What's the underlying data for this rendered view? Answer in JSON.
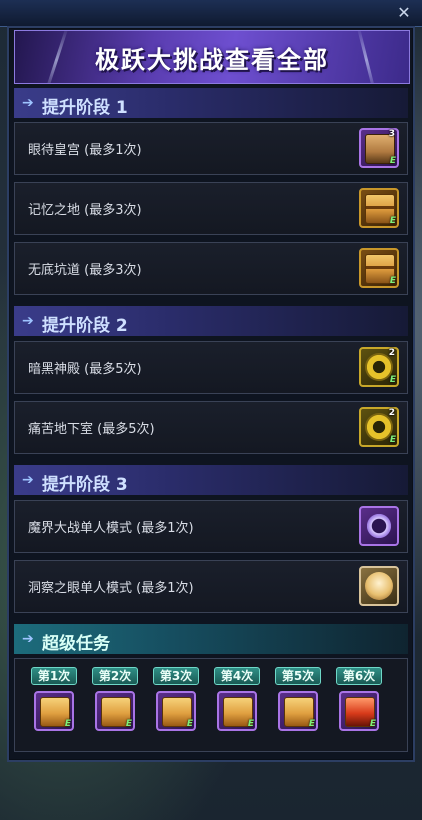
{
  "window": {
    "close_label": "✕"
  },
  "title": "极跃大挑战查看全部",
  "sections": [
    {
      "label": "提升阶段 1",
      "rows": [
        {
          "name": "眼待皇宫 (最多1次)",
          "icon": "purple-treasure-chest-icon",
          "count": "3"
        },
        {
          "name": "记忆之地 (最多3次)",
          "icon": "gold-treasure-chest-icon",
          "count": ""
        },
        {
          "name": "无底坑道 (最多3次)",
          "icon": "gold-treasure-chest-icon",
          "count": ""
        }
      ]
    },
    {
      "label": "提升阶段 2",
      "rows": [
        {
          "name": "暗黑神殿 (最多5次)",
          "icon": "golden-gear-icon",
          "count": "2"
        },
        {
          "name": "痛苦地下室 (最多5次)",
          "icon": "golden-gear-icon",
          "count": "2"
        }
      ]
    },
    {
      "label": "提升阶段 3",
      "rows": [
        {
          "name": "魔界大战单人模式 (最多1次)",
          "icon": "purple-ring-icon",
          "count": ""
        },
        {
          "name": "洞察之眼单人模式 (最多1次)",
          "icon": "white-mask-icon",
          "count": ""
        }
      ]
    }
  ],
  "super_task": {
    "label": "超级任务",
    "slots": [
      {
        "tag": "第1次",
        "icon": "gold-box-icon"
      },
      {
        "tag": "第2次",
        "icon": "gold-box-icon"
      },
      {
        "tag": "第3次",
        "icon": "gold-box-icon"
      },
      {
        "tag": "第4次",
        "icon": "gold-box-icon"
      },
      {
        "tag": "第5次",
        "icon": "gold-box-icon"
      },
      {
        "tag": "第6次",
        "icon": "red-box-icon"
      }
    ]
  },
  "badge_text": "E",
  "colors": {
    "panel_bg": "#0e1420",
    "section_header": "#3a3c8a",
    "super_header": "#1d6c7c",
    "badge_green": "#7df07a"
  }
}
